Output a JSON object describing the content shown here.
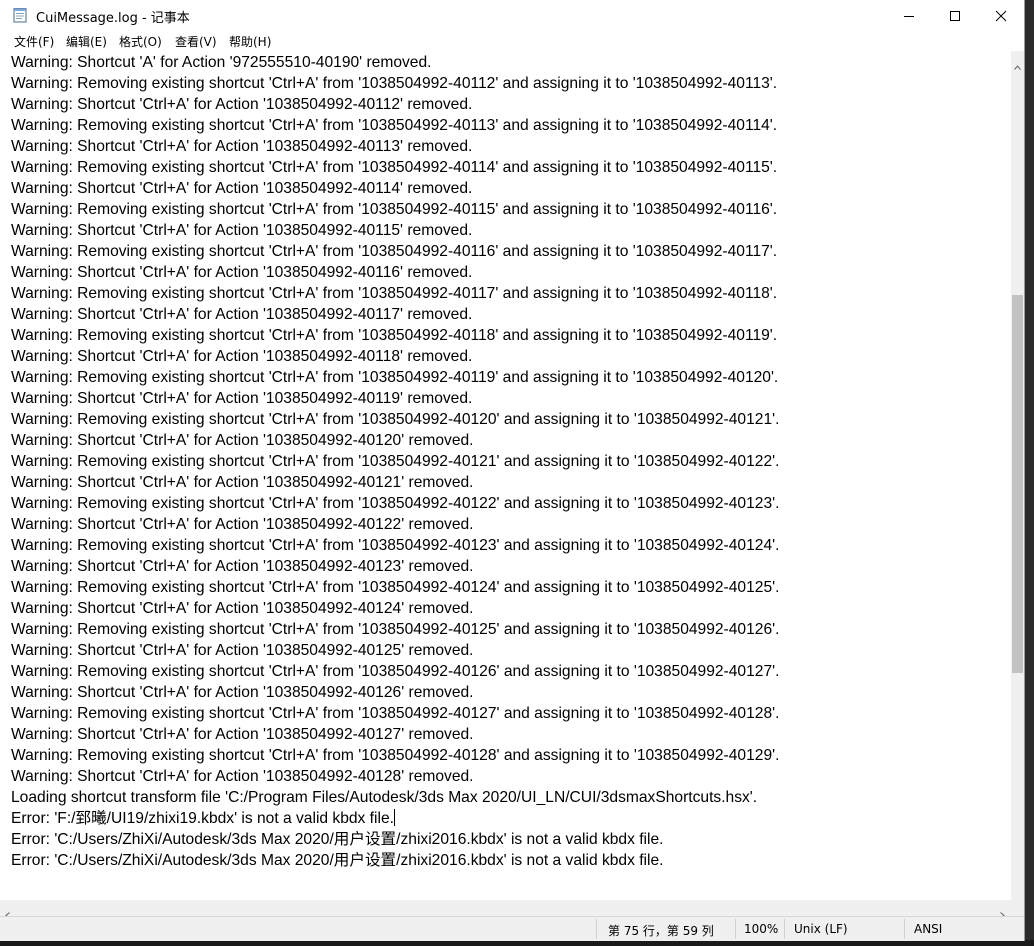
{
  "window": {
    "title": "CuiMessage.log - 记事本",
    "app_icon": "notepad-icon",
    "caption_icons": [
      "minimize-icon",
      "maximize-icon",
      "close-icon"
    ]
  },
  "menu": [
    {
      "label": "文件(F)"
    },
    {
      "label": "编辑(E)"
    },
    {
      "label": "格式(O)"
    },
    {
      "label": "查看(V)"
    },
    {
      "label": "帮助(H)"
    }
  ],
  "content": {
    "lines": [
      "Warning: Shortcut 'A' for Action '972555510-40190' removed.",
      "Warning: Removing existing shortcut 'Ctrl+A' from '1038504992-40112' and assigning it to '1038504992-40113'.",
      "Warning: Shortcut 'Ctrl+A' for Action '1038504992-40112' removed.",
      "Warning: Removing existing shortcut 'Ctrl+A' from '1038504992-40113' and assigning it to '1038504992-40114'.",
      "Warning: Shortcut 'Ctrl+A' for Action '1038504992-40113' removed.",
      "Warning: Removing existing shortcut 'Ctrl+A' from '1038504992-40114' and assigning it to '1038504992-40115'.",
      "Warning: Shortcut 'Ctrl+A' for Action '1038504992-40114' removed.",
      "Warning: Removing existing shortcut 'Ctrl+A' from '1038504992-40115' and assigning it to '1038504992-40116'.",
      "Warning: Shortcut 'Ctrl+A' for Action '1038504992-40115' removed.",
      "Warning: Removing existing shortcut 'Ctrl+A' from '1038504992-40116' and assigning it to '1038504992-40117'.",
      "Warning: Shortcut 'Ctrl+A' for Action '1038504992-40116' removed.",
      "Warning: Removing existing shortcut 'Ctrl+A' from '1038504992-40117' and assigning it to '1038504992-40118'.",
      "Warning: Shortcut 'Ctrl+A' for Action '1038504992-40117' removed.",
      "Warning: Removing existing shortcut 'Ctrl+A' from '1038504992-40118' and assigning it to '1038504992-40119'.",
      "Warning: Shortcut 'Ctrl+A' for Action '1038504992-40118' removed.",
      "Warning: Removing existing shortcut 'Ctrl+A' from '1038504992-40119' and assigning it to '1038504992-40120'.",
      "Warning: Shortcut 'Ctrl+A' for Action '1038504992-40119' removed.",
      "Warning: Removing existing shortcut 'Ctrl+A' from '1038504992-40120' and assigning it to '1038504992-40121'.",
      "Warning: Shortcut 'Ctrl+A' for Action '1038504992-40120' removed.",
      "Warning: Removing existing shortcut 'Ctrl+A' from '1038504992-40121' and assigning it to '1038504992-40122'.",
      "Warning: Shortcut 'Ctrl+A' for Action '1038504992-40121' removed.",
      "Warning: Removing existing shortcut 'Ctrl+A' from '1038504992-40122' and assigning it to '1038504992-40123'.",
      "Warning: Shortcut 'Ctrl+A' for Action '1038504992-40122' removed.",
      "Warning: Removing existing shortcut 'Ctrl+A' from '1038504992-40123' and assigning it to '1038504992-40124'.",
      "Warning: Shortcut 'Ctrl+A' for Action '1038504992-40123' removed.",
      "Warning: Removing existing shortcut 'Ctrl+A' from '1038504992-40124' and assigning it to '1038504992-40125'.",
      "Warning: Shortcut 'Ctrl+A' for Action '1038504992-40124' removed.",
      "Warning: Removing existing shortcut 'Ctrl+A' from '1038504992-40125' and assigning it to '1038504992-40126'.",
      "Warning: Shortcut 'Ctrl+A' for Action '1038504992-40125' removed.",
      "Warning: Removing existing shortcut 'Ctrl+A' from '1038504992-40126' and assigning it to '1038504992-40127'.",
      "Warning: Shortcut 'Ctrl+A' for Action '1038504992-40126' removed.",
      "Warning: Removing existing shortcut 'Ctrl+A' from '1038504992-40127' and assigning it to '1038504992-40128'.",
      "Warning: Shortcut 'Ctrl+A' for Action '1038504992-40127' removed.",
      "Warning: Removing existing shortcut 'Ctrl+A' from '1038504992-40128' and assigning it to '1038504992-40129'.",
      "Warning: Shortcut 'Ctrl+A' for Action '1038504992-40128' removed.",
      "Loading shortcut transform file 'C:/Program Files/Autodesk/3ds Max 2020/UI_LN/CUI/3dsmaxShortcuts.hsx'.",
      "Error: 'F:/郅曦/UI19/zhixi19.kbdx' is not a valid kbdx file.",
      "Error: 'C:/Users/ZhiXi/Autodesk/3ds Max 2020/用户设置/zhixi2016.kbdx' is not a valid kbdx file.",
      "Error: 'C:/Users/ZhiXi/Autodesk/3ds Max 2020/用户设置/zhixi2016.kbdx' is not a valid kbdx file."
    ],
    "caret_line": 36
  },
  "scrollbar": {
    "position_fraction": 0.52,
    "thumb_fraction": 0.46
  },
  "status": {
    "position": "第 75 行，第 59 列",
    "zoom": "100%",
    "line_ending": "Unix (LF)",
    "encoding": "ANSI"
  }
}
